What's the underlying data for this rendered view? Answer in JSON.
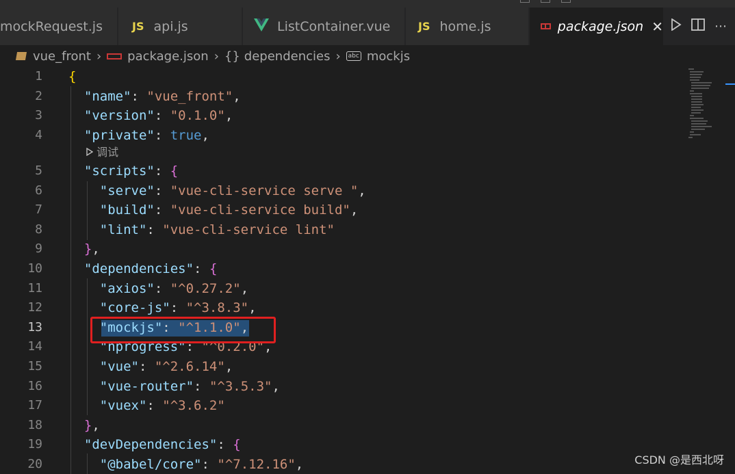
{
  "tabs": [
    {
      "label": "mockRequest.js",
      "icon": "js-icon",
      "active": false
    },
    {
      "label": "api.js",
      "icon_text": "JS",
      "active": false
    },
    {
      "label": "ListContainer.vue",
      "icon": "vue-icon",
      "active": false
    },
    {
      "label": "home.js",
      "icon_text": "JS",
      "active": false
    },
    {
      "label": "package.json",
      "icon": "npm-icon",
      "active": true,
      "close": "✕"
    }
  ],
  "breadcrumb": {
    "folder": "vue_front",
    "file": "package.json",
    "section_braces": "{}",
    "section": "dependencies",
    "key_icon_text": "abc",
    "key": "mockjs"
  },
  "code_lens": "调试",
  "line_numbers": [
    "1",
    "2",
    "3",
    "4",
    "5",
    "6",
    "7",
    "8",
    "9",
    "10",
    "11",
    "12",
    "13",
    "14",
    "15",
    "16",
    "17",
    "18",
    "19",
    "20"
  ],
  "current_line": "13",
  "json": {
    "name": "vue_front",
    "version": "0.1.0",
    "private": "true",
    "scripts": {
      "serve": "vue-cli-service serve ",
      "build": "vue-cli-service build",
      "lint": "vue-cli-service lint"
    },
    "dependencies": {
      "axios": "^0.27.2",
      "core-js": "^3.8.3",
      "mockjs": "^1.1.0",
      "nprogress": "^0.2.0",
      "vue": "^2.6.14",
      "vue-router": "^3.5.3",
      "vuex": "^3.6.2"
    },
    "devDependencies": {
      "babel_core": "^7.12.16"
    }
  },
  "keys": {
    "name": "\"name\"",
    "version": "\"version\"",
    "private": "\"private\"",
    "scripts": "\"scripts\"",
    "serve": "\"serve\"",
    "build": "\"build\"",
    "lint": "\"lint\"",
    "dependencies": "\"dependencies\"",
    "axios": "\"axios\"",
    "core_js": "\"core-js\"",
    "mockjs": "\"mockjs\"",
    "nprogress": "\"nprogress\"",
    "vue": "\"vue\"",
    "vue_router": "\"vue-router\"",
    "vuex": "\"vuex\"",
    "devDependencies": "\"devDependencies\"",
    "babel_core": "\"@babel/core\""
  },
  "values": {
    "name": "\"vue_front\"",
    "version": "\"0.1.0\"",
    "private": "true",
    "serve": "\"vue-cli-service serve \"",
    "build": "\"vue-cli-service build\"",
    "lint": "\"vue-cli-service lint\"",
    "axios": "\"^0.27.2\"",
    "core_js": "\"^3.8.3\"",
    "mockjs": "\"^1.1.0\"",
    "nprogress": "\"^0.2.0\"",
    "vue": "\"^2.6.14\"",
    "vue_router": "\"^3.5.3\"",
    "vuex": "\"^3.6.2\"",
    "babel_core": "\"^7.12.16\""
  },
  "watermark": "CSDN @是西北呀",
  "colors": {
    "highlight_box": "#e02020",
    "selection": "#264f78",
    "key": "#9cdcfe",
    "string": "#ce9178"
  }
}
